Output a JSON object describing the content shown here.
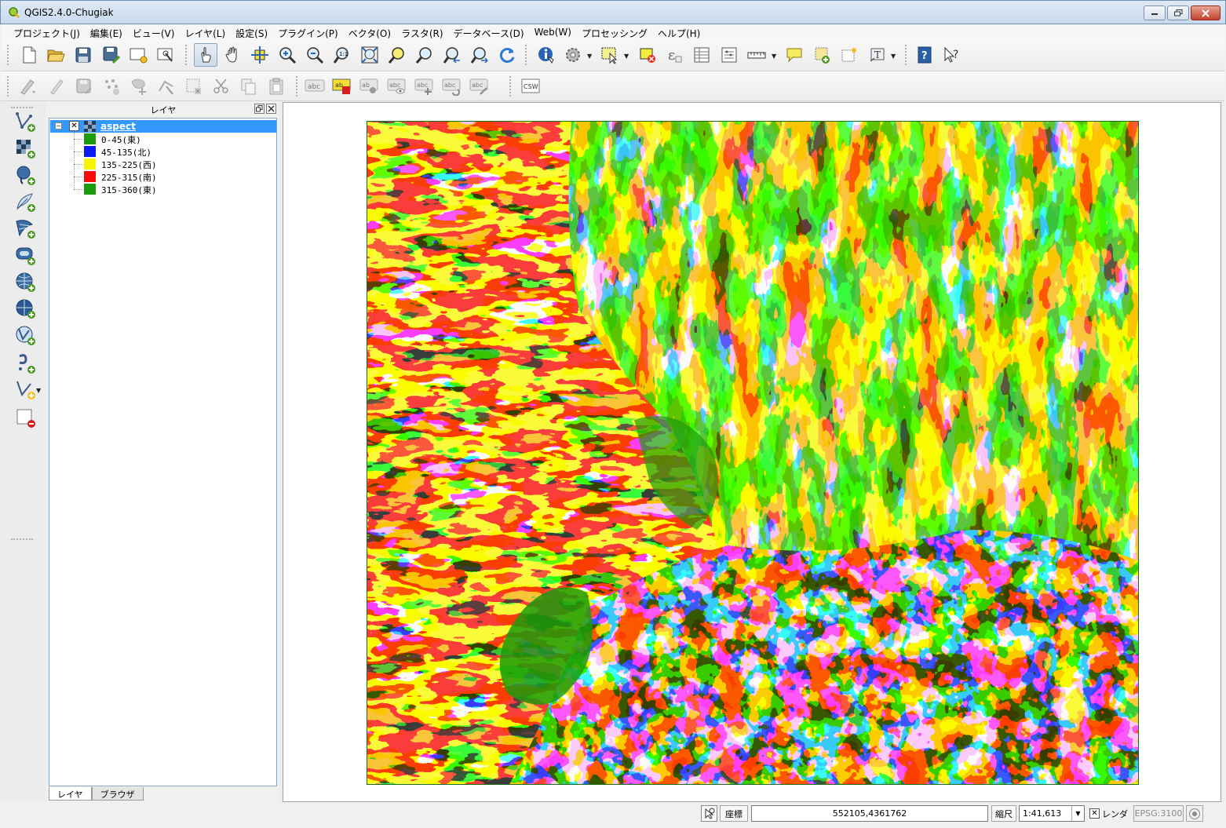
{
  "window": {
    "title": "QGIS2.4.0-Chugiak"
  },
  "menu": [
    "プロジェクト(J)",
    "編集(E)",
    "ビュー(V)",
    "レイヤ(L)",
    "設定(S)",
    "プラグイン(P)",
    "ベクタ(O)",
    "ラスタ(R)",
    "データベース(D)",
    "Web(W)",
    "プロセッシング",
    "ヘルプ(H)"
  ],
  "toolbar2": {
    "csw_label": "CSW",
    "label_tool_text": "abc"
  },
  "layers_panel": {
    "title": "レイヤ",
    "layer_name": "aspect",
    "legend": [
      {
        "label": "0-45(東)",
        "color": "#1c9b0c"
      },
      {
        "label": "45-135(北)",
        "color": "#0b1bf2"
      },
      {
        "label": "135-225(西)",
        "color": "#f5f500"
      },
      {
        "label": "225-315(南)",
        "color": "#f40d0b"
      },
      {
        "label": "315-360(東)",
        "color": "#1c9b0c"
      }
    ],
    "tabs": [
      "レイヤ",
      "ブラウザ"
    ]
  },
  "statusbar": {
    "coord_label": "座標",
    "coord_value": "552105,4361762",
    "scale_label": "縮尺",
    "scale_value": "1:41,613",
    "render_label": "レンダ",
    "crs": "EPSG:3100"
  }
}
